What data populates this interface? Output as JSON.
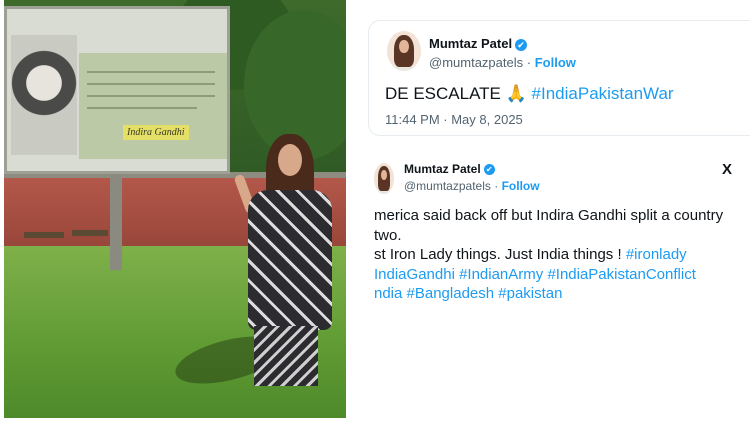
{
  "photo": {
    "billboard_name": "Indira Gandhi"
  },
  "tweet1": {
    "display_name": "Mumtaz Patel",
    "verified_icon": "✔",
    "handle": "@mumtazpatels",
    "separator": "·",
    "follow_label": "Follow",
    "text_plain": "DE ESCALATE ",
    "emoji": "🙏",
    "hashtag": "#IndiaPakistanWar",
    "timestamp": "11:44 PM · May 8, 2025"
  },
  "tweet2": {
    "display_name": "Mumtaz Patel",
    "verified_icon": "✔",
    "handle": "@mumtazpatels",
    "separator": "·",
    "follow_label": "Follow",
    "x_logo": "X",
    "line1": "merica said back off but Indira Gandhi split a country",
    "line2": " two.",
    "line3_plain": "st Iron Lady things. Just India things ! ",
    "line3_tag": "#ironlady",
    "line4": "IndiaGandhi #IndianArmy #IndiaPakistanConflict",
    "line5": "ndia #Bangladesh #pakistan"
  },
  "colors": {
    "link": "#1d9bf0",
    "text": "#0f1419",
    "muted": "#536471"
  }
}
